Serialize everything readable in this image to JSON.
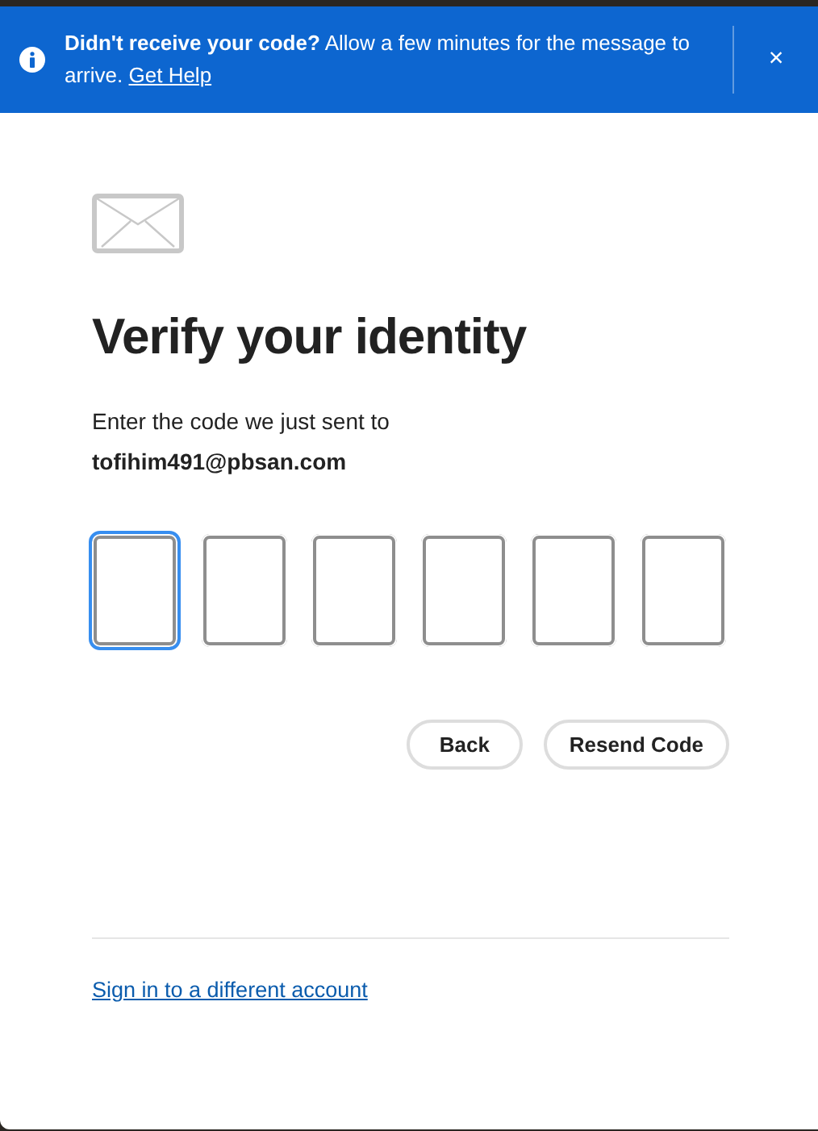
{
  "toast": {
    "title": "Didn't receive your code?",
    "message": "Allow a few minutes for the message to arrive.",
    "link": "Get Help",
    "close": "×"
  },
  "heading": "Verify your identity",
  "instruction": "Enter the code we just sent to",
  "email": "tofihim491@pbsan.com",
  "code_fields": [
    {
      "focused": true
    },
    {
      "focused": false
    },
    {
      "focused": false
    },
    {
      "focused": false
    },
    {
      "focused": false
    },
    {
      "focused": false
    }
  ],
  "buttons": [
    "Back",
    "Resend Code"
  ],
  "footer_link": "Sign in to a different account"
}
